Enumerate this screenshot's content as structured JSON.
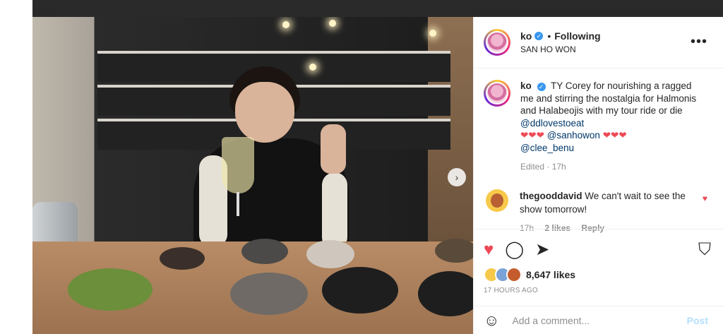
{
  "post": {
    "username": "ko",
    "separator": "•",
    "following_label": "Following",
    "location": "SAN HO WON",
    "more_label": "•••",
    "next_label": "›"
  },
  "caption": {
    "username": "ko",
    "text_1": "TY Corey for nourishing a ragged me and stirring the nostalgia for Halmonis and Halabeojis with my tour ride or die ",
    "mention_1": "@ddlovestoeat",
    "hearts_1": "❤❤❤ ",
    "mention_2": "@sanhowon",
    "hearts_2": " ❤❤❤",
    "mention_3": "@clee_benu",
    "meta": "Edited · 17h"
  },
  "comment": {
    "username": "thegooddavid",
    "text": " We can't wait to see the show tomorrow!",
    "time": "17h",
    "likes": "2 likes",
    "reply": "Reply",
    "heart": "♥"
  },
  "actions": {
    "like_icon": "♥",
    "comment_icon": "◯",
    "share_icon": "➤",
    "save_icon": "⛉",
    "likes": "8,647 likes",
    "timestamp": "17 HOURS AGO"
  },
  "add_comment": {
    "emoji": "☺",
    "placeholder": "Add a comment...",
    "post": "Post"
  },
  "colors": {
    "like": "#ed4956",
    "link": "#00376b",
    "post_disabled": "#b2dffc"
  }
}
